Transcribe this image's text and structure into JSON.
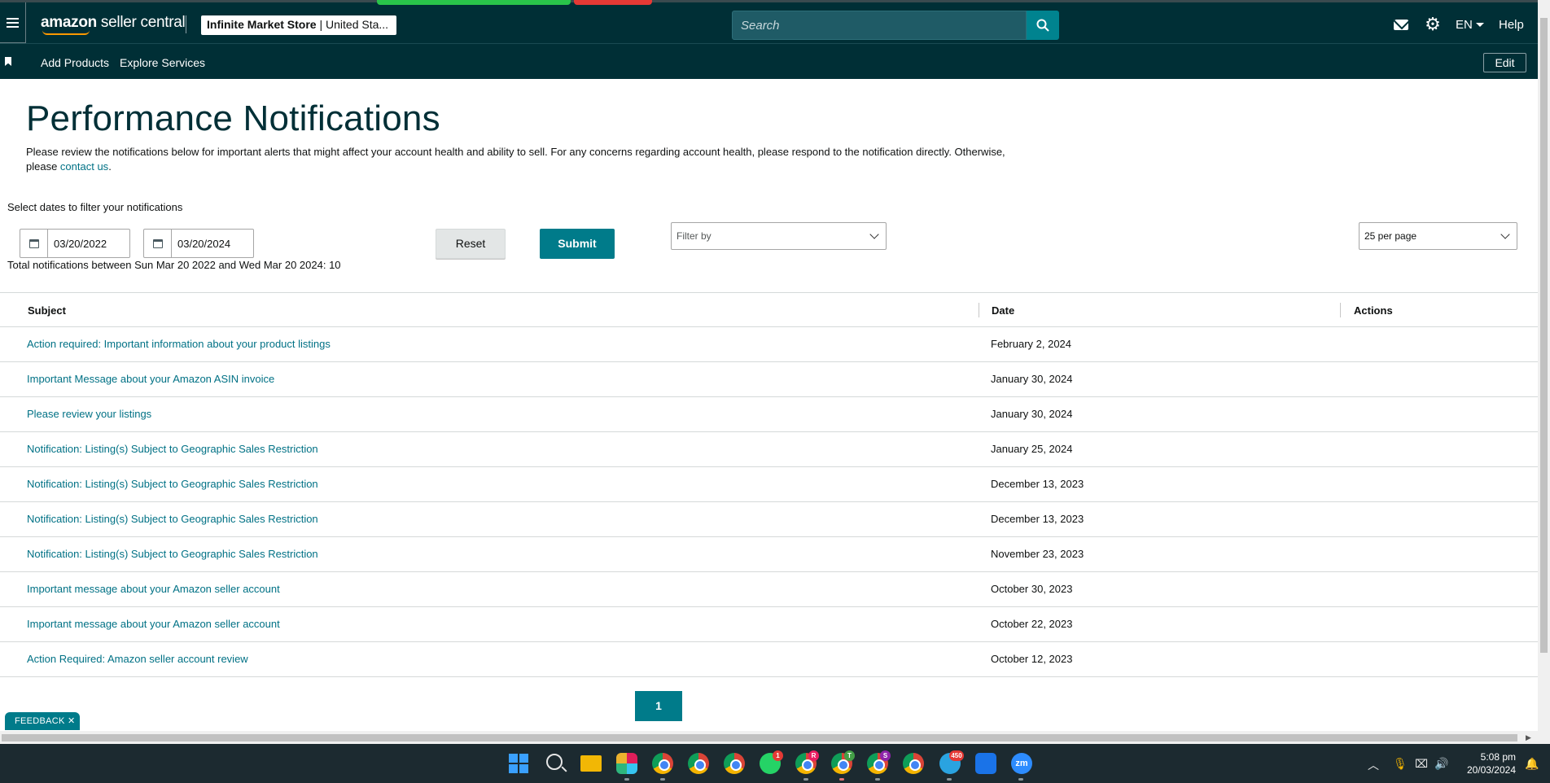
{
  "header": {
    "logo_main": "amazon",
    "logo_sub": " seller central",
    "store_name": "Infinite Market Store",
    "store_region": " | United Sta...",
    "search_placeholder": "Search",
    "language": "EN",
    "help_label": "Help"
  },
  "subnav": {
    "items": [
      "Add Products",
      "Explore Services"
    ],
    "edit_label": "Edit"
  },
  "main": {
    "title": "Performance Notifications",
    "intro_text": "Please review the notifications below for important alerts that might affect your account health and ability to sell. For any concerns regarding account health, please respond to the notification directly. Otherwise, please ",
    "intro_link": "contact us",
    "intro_end": ".",
    "filter_label": "Select dates to filter your notifications",
    "start_date": "03/20/2022",
    "end_date": "03/20/2024",
    "reset_label": "Reset",
    "submit_label": "Submit",
    "filter_placeholder": "Filter by",
    "per_page": "25 per page",
    "total_text": "Total notifications between Sun Mar 20 2022 and Wed Mar 20 2024: 10"
  },
  "table": {
    "columns": [
      "Subject",
      "Date",
      "Actions"
    ],
    "rows": [
      {
        "subject": "Action required: Important information about your product listings",
        "date": "February 2, 2024"
      },
      {
        "subject": "Important Message about your Amazon ASIN invoice",
        "date": "January 30, 2024"
      },
      {
        "subject": "Please review your listings",
        "date": "January 30, 2024"
      },
      {
        "subject": "Notification: Listing(s) Subject to Geographic Sales Restriction",
        "date": "January 25, 2024"
      },
      {
        "subject": "Notification: Listing(s) Subject to Geographic Sales Restriction",
        "date": "December 13, 2023"
      },
      {
        "subject": "Notification: Listing(s) Subject to Geographic Sales Restriction",
        "date": "December 13, 2023"
      },
      {
        "subject": "Notification: Listing(s) Subject to Geographic Sales Restriction",
        "date": "November 23, 2023"
      },
      {
        "subject": "Important message about your Amazon seller account",
        "date": "October 30, 2023"
      },
      {
        "subject": "Important message about your Amazon seller account",
        "date": "October 22, 2023"
      },
      {
        "subject": "Action Required: Amazon seller account review",
        "date": "October 12, 2023"
      }
    ]
  },
  "pagination": {
    "current_page": "1"
  },
  "feedback": {
    "label": "FEEDBACK ✕"
  },
  "taskbar": {
    "time": "5:08 pm",
    "date": "20/03/2024",
    "badges": {
      "whatsapp": "1",
      "chrome_r": "R",
      "chrome_t": "T",
      "chrome_s": "S",
      "telegram": "450"
    }
  },
  "colors": {
    "header_bg": "#002f36",
    "accent": "#007b8a",
    "link": "#007185"
  }
}
